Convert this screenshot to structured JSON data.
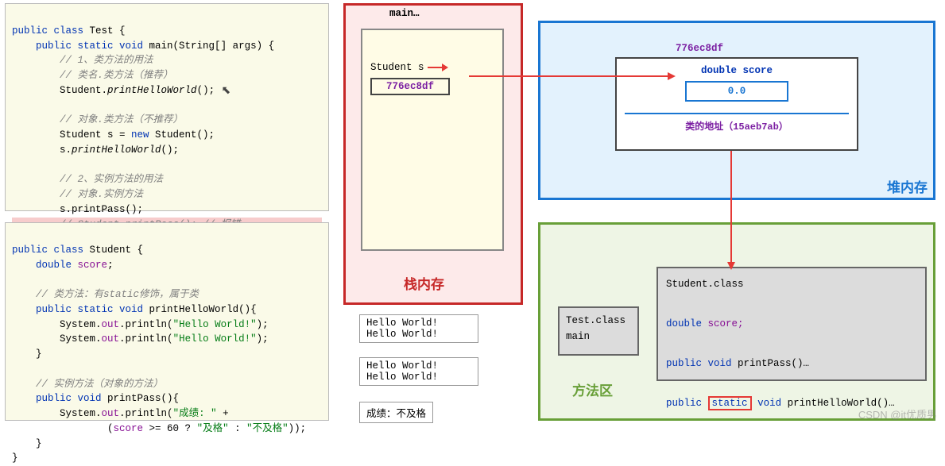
{
  "code1": {
    "l1": "public class Test {",
    "l2": "    public static void main(String[] args) {",
    "l3": "        // 1、类方法的用法",
    "l4": "        // 类名.类方法（推荐）",
    "l5": "        Student.printHelloWorld();",
    "l6": "        // 对象.类方法（不推荐）",
    "l7": "        Student s = new Student();",
    "l8": "        s.printHelloWorld();",
    "l9": "        // 2、实例方法的用法",
    "l10": "        // 对象.实例方法",
    "l11": "        s.printPass();",
    "l12": "        // Student.printPass(); // 报错",
    "l13": "    }",
    "l14": "}"
  },
  "code2": {
    "l1": "public class Student {",
    "l2": "    double score;",
    "l3": "    // 类方法：有static修饰，属于类",
    "l4": "    public static void printHelloWorld(){",
    "l5": "        System.out.println(\"Hello World!\");",
    "l6": "        System.out.println(\"Hello World!\");",
    "l7": "    }",
    "l8": "    // 实例方法（对象的方法）",
    "l9": "    public void printPass(){",
    "l10": "        System.out.println(\"成绩: \" +",
    "l11": "                (score >= 60 ? \"及格\" : \"不及格\"));",
    "l12": "    }",
    "l13": "}"
  },
  "stack": {
    "title": "栈内存",
    "frame": "main…",
    "var": "Student s",
    "ptr": "776ec8df"
  },
  "heap": {
    "title": "堆内存",
    "addr": "776ec8df",
    "score_kw": "double",
    "score_name": "score",
    "score_val": "0.0",
    "classref": "类的地址（15aeb7ab）"
  },
  "method_area": {
    "title": "方法区",
    "test": {
      "l1": "Test.class",
      "l2": "main"
    },
    "stu": {
      "l1": "Student.class",
      "l2_kw": "double",
      "l2_name": "score;",
      "l3_pre": "public void printPass()…",
      "l4_pre": "public ",
      "l4_static": "static",
      "l4_post": " void printHelloWorld()…"
    }
  },
  "output": {
    "b1a": "Hello World!",
    "b1b": "Hello World!",
    "b2a": "Hello World!",
    "b2b": "Hello World!",
    "b3": "成绩：不及格"
  },
  "watermark": "CSDN @it优质男"
}
